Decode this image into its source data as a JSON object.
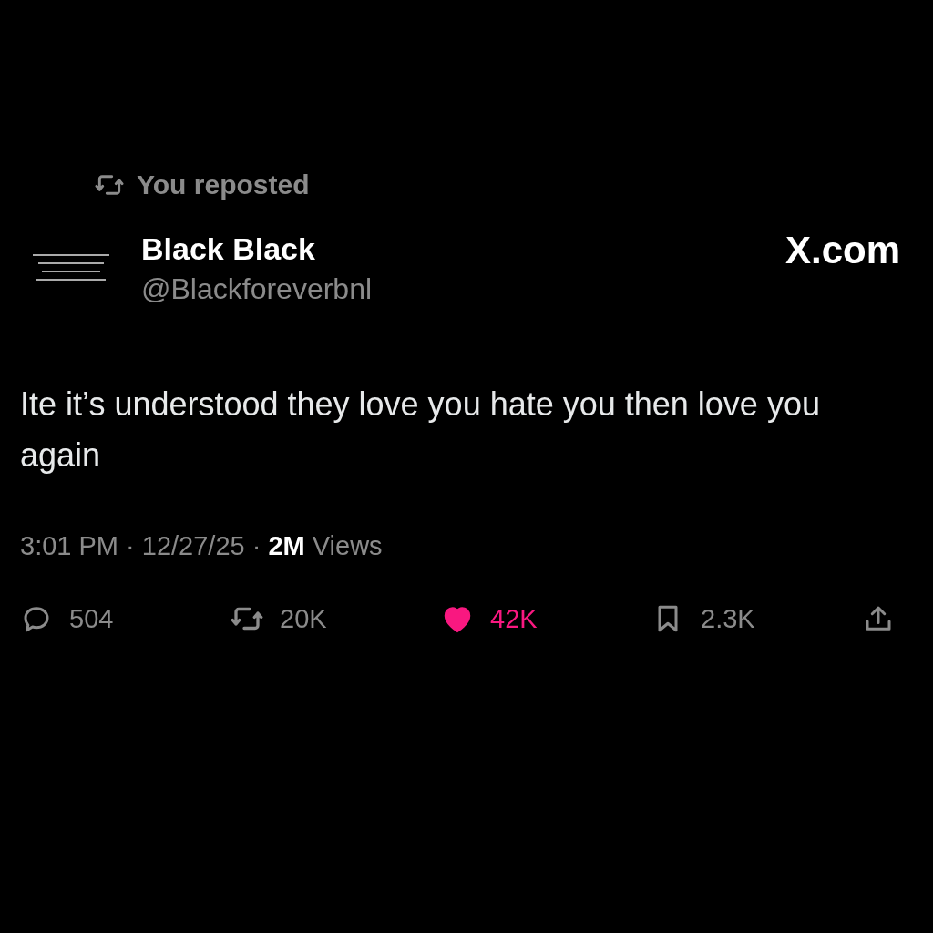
{
  "repost_banner": {
    "text": "You reposted"
  },
  "author": {
    "name": "Black Black",
    "handle": "@Blackforeverbnl"
  },
  "site_label": "X.com",
  "tweet_text": "Ite it’s understood they love you hate you then love you again",
  "meta": "3:01 PM · 12/27/25 · **2M** Views",
  "actions": [
    {
      "kind": "reply",
      "count": "504",
      "active": false
    },
    {
      "kind": "repost",
      "count": "20K",
      "active": false
    },
    {
      "kind": "like",
      "count": "42K",
      "active": true
    },
    {
      "kind": "bookmark",
      "count": "2.3K",
      "active": false
    },
    {
      "kind": "share",
      "active": false
    }
  ]
}
